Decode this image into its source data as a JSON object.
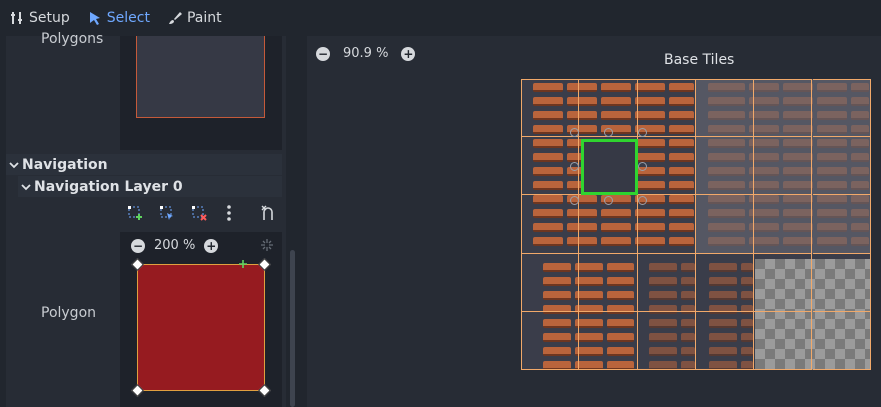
{
  "toolbar": {
    "tools": [
      {
        "label": "Setup",
        "icon": "setup-icon",
        "active": false
      },
      {
        "label": "Select",
        "icon": "select-cursor-icon",
        "active": true
      },
      {
        "label": "Paint",
        "icon": "paint-brush-icon",
        "active": false
      }
    ],
    "accent_color": "#6fa8ff"
  },
  "inspector": {
    "polygons_label": "Polygons",
    "navigation_section": "Navigation",
    "navigation_layer": "Navigation Layer 0",
    "polygon_label": "Polygon",
    "polygon_toolbar_icons": [
      "add-point-icon",
      "edit-point-icon",
      "delete-point-icon",
      "more-icon",
      "reset-icon"
    ],
    "zoom": {
      "value": "200 %",
      "minus": "−",
      "plus": "+"
    },
    "polygon_fill_color": "#961b20"
  },
  "atlas": {
    "title": "Base Tiles",
    "zoom": {
      "value": "90.9 %",
      "minus": "−",
      "plus": "+"
    },
    "selection_color": "#2fd42f",
    "grid_color": "#f1a96a"
  }
}
